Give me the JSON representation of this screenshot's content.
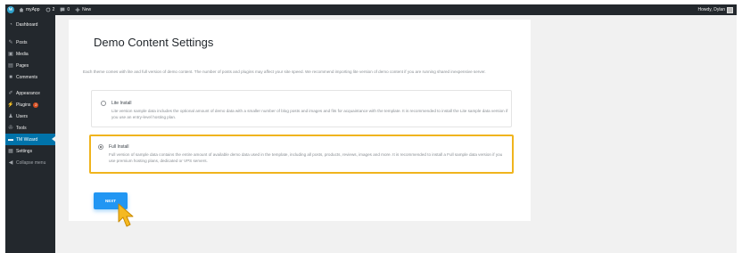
{
  "adminbar": {
    "site_name": "myApp",
    "updates_count": "2",
    "comments_count": "0",
    "new_label": "New",
    "greeting": "Howdy, Dylan"
  },
  "sidebar": {
    "items": [
      {
        "label": "Dashboard",
        "icon": "dashboard-icon"
      },
      {
        "label": "Posts",
        "icon": "pin-icon"
      },
      {
        "label": "Media",
        "icon": "media-icon"
      },
      {
        "label": "Pages",
        "icon": "pages-icon"
      },
      {
        "label": "Comments",
        "icon": "comment-icon"
      },
      {
        "label": "Appearance",
        "icon": "brush-icon"
      },
      {
        "label": "Plugins",
        "icon": "plugin-icon",
        "badge": "2"
      },
      {
        "label": "Users",
        "icon": "users-icon"
      },
      {
        "label": "Tools",
        "icon": "wrench-icon"
      },
      {
        "label": "TM Wizard",
        "icon": "wizard-icon",
        "active": true
      },
      {
        "label": "Settings",
        "icon": "settings-icon"
      },
      {
        "label": "Collapse menu",
        "icon": "collapse-icon"
      }
    ]
  },
  "main": {
    "title": "Demo Content Settings",
    "intro": "Each theme comes with lite and full version of demo content. The number of posts and plugins may affect your site speed. We recommend importing lite version of demo content if you are running shared inexpensive server.",
    "options": [
      {
        "label": "Lite Install",
        "description": "Lite version sample data includes the optional amount of demo data with a smaller number of blog posts and images and fits for acquaintance with the template. It is recommended to install the Lite sample data version if you use an entry-level hosting plan.",
        "selected": false
      },
      {
        "label": "Full Install",
        "description": "Full version of sample data contains the entire amount of available demo data used in the template, including all posts, products, reviews, images and more. It is recommended to install a Full sample data version if you use premium hosting plans, dedicated or VPS servers.",
        "selected": true
      }
    ],
    "next_label": "NEXT"
  },
  "colors": {
    "accent": "#2196f3",
    "highlight_border": "#f0b41d",
    "admin_bg": "#23282d",
    "active_menu": "#0073aa"
  }
}
